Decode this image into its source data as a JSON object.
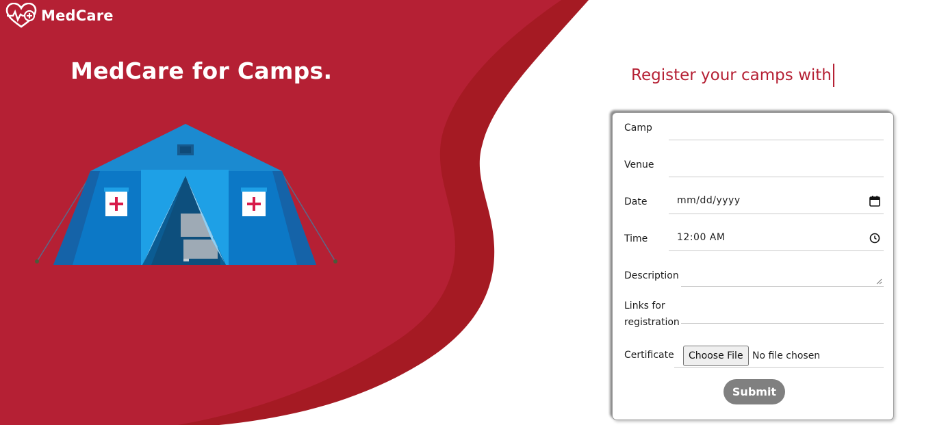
{
  "brand": {
    "name": "MedCare",
    "logo_icon": "heart-plus-icon"
  },
  "hero": {
    "title": "MedCare for Camps."
  },
  "register": {
    "heading": "Register your camps with"
  },
  "form": {
    "camp_label": "Camp",
    "camp_value": "",
    "venue_label": "Venue",
    "venue_value": "",
    "date_label": "Date",
    "date_value": "mm/dd/yyyy",
    "date_icon": "calendar-icon",
    "time_label": "Time",
    "time_value": "12:00 AM",
    "time_icon": "clock-icon",
    "description_label": "Description",
    "links_label_line1": "Links for",
    "links_label_line2": "registration",
    "certificate_label": "Certificate",
    "choose_file_label": "Choose File",
    "file_status": "No file chosen",
    "submit_label": "Submit"
  },
  "colors": {
    "primary_red": "#b52034",
    "dark_red": "#a51a23",
    "submit_gray": "#808080"
  }
}
